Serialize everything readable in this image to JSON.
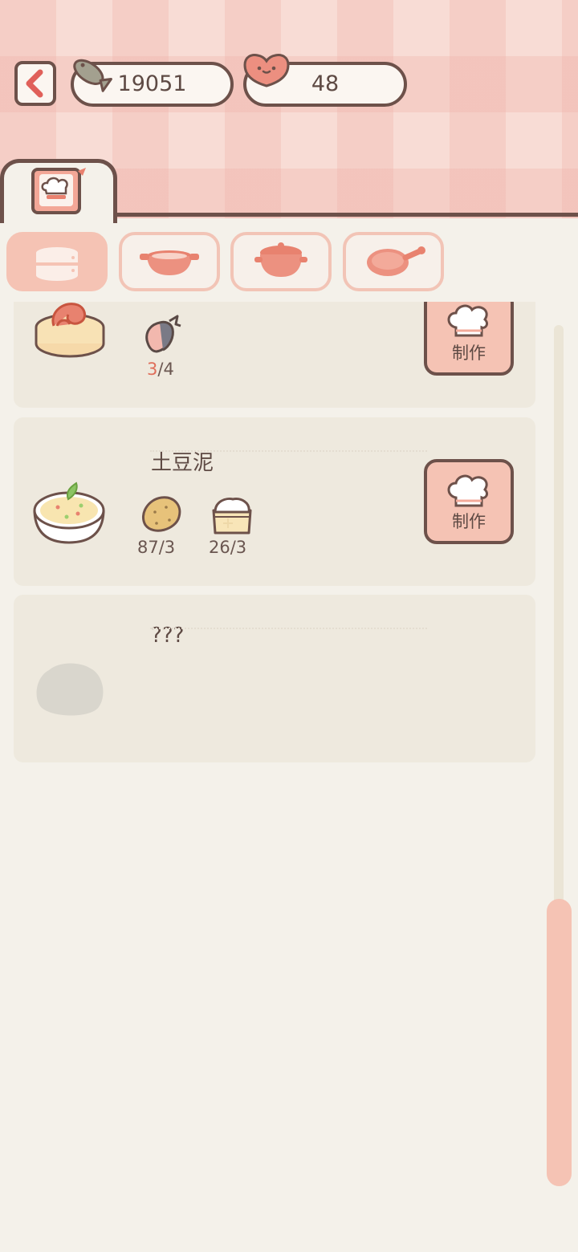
{
  "currency": {
    "fish": "19051",
    "hearts": "48"
  },
  "icons": {
    "back": "chevron-left-icon",
    "fish": "fish-icon",
    "heart": "heart-icon",
    "recipe_book": "recipe-book-icon",
    "categories": [
      "steamer-icon",
      "wok-icon",
      "pot-icon",
      "frying-pan-icon"
    ],
    "make": "chef-hat-icon"
  },
  "categories": {
    "active_index": 0
  },
  "recipes": [
    {
      "name": "",
      "ingredients": [
        {
          "icon": "fish-ingredient-icon",
          "have": "3",
          "need": "/4",
          "insufficient": true
        }
      ],
      "make_label": "制作"
    },
    {
      "name": "土豆泥",
      "ingredients": [
        {
          "icon": "potato-icon",
          "have": "87",
          "need": "/3",
          "insufficient": false
        },
        {
          "icon": "flour-icon",
          "have": "26",
          "need": "/3",
          "insufficient": false
        }
      ],
      "make_label": "制作"
    },
    {
      "name": "???",
      "ingredients": [],
      "locked": true
    }
  ],
  "colors": {
    "outline": "#6d514a",
    "accent": "#f5c3b4",
    "card": "#eee9de",
    "background": "#f4f1ea",
    "insufficient": "#df6e5a"
  }
}
